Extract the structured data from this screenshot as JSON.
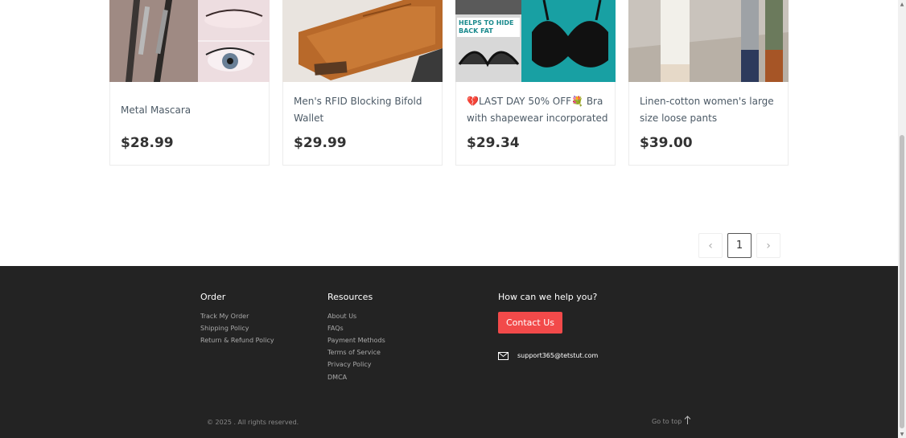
{
  "products": [
    {
      "name": "Metal Mascara",
      "price": "$28.99"
    },
    {
      "name": "Men's RFID Blocking Bifold Wallet",
      "price": "$29.99"
    },
    {
      "name": "💔LAST DAY 50% OFF💐 Bra with shapewear incorporated",
      "price": "$29.34",
      "image_text": "HELPS TO HIDE BACK FAT"
    },
    {
      "name": "Linen-cotton women's large size loose pants",
      "price": "$39.00"
    }
  ],
  "pagination": {
    "prev": "‹",
    "current": "1",
    "next": "›"
  },
  "footer": {
    "order": {
      "title": "Order",
      "links": [
        "Track My Order",
        "Shipping Policy",
        "Return & Refund Policy"
      ]
    },
    "resources": {
      "title": "Resources",
      "links": [
        "About Us",
        "FAQs",
        "Payment Methods",
        "Terms of Service",
        "Privacy Policy",
        "DMCA"
      ]
    },
    "help": {
      "title": "How can we help you?",
      "contact_label": "Contact Us",
      "email": "support365@tetstut.com"
    },
    "copyright": "© 2025 . All rights reserved.",
    "go_top": "Go to top"
  },
  "colors": {
    "accent": "#f24a4a",
    "footer_bg": "#232323"
  }
}
